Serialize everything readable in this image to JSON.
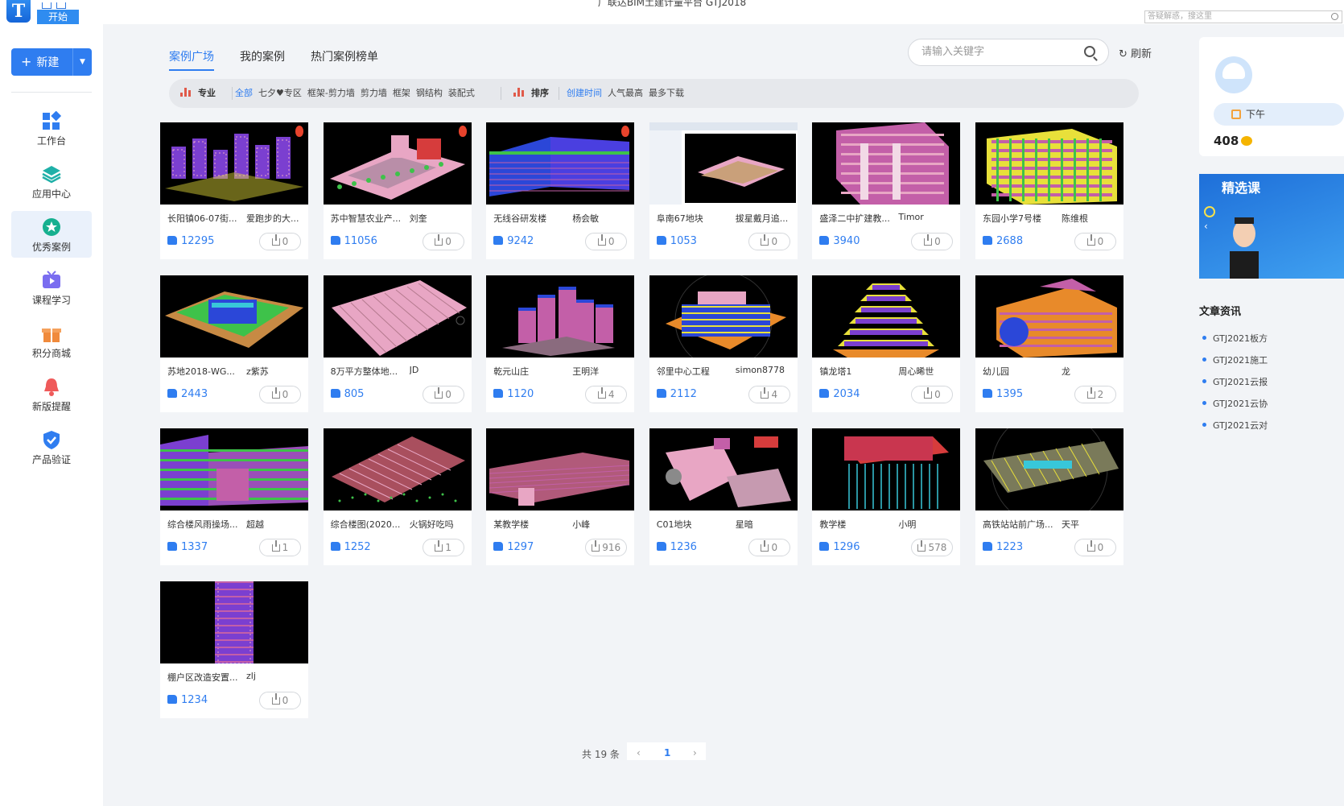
{
  "window": {
    "title": "广联达BIM土建计量平台 GTJ2018",
    "start_tab": "开始",
    "logo_letter": "T",
    "help_search_placeholder": "答疑解惑，搜这里"
  },
  "sidebar": {
    "new_button": "新建",
    "items": [
      {
        "label": "工作台",
        "icon": "workbench-icon"
      },
      {
        "label": "应用中心",
        "icon": "layers-icon"
      },
      {
        "label": "优秀案例",
        "icon": "star-icon",
        "active": true
      },
      {
        "label": "课程学习",
        "icon": "tv-icon"
      },
      {
        "label": "积分商城",
        "icon": "gift-icon"
      },
      {
        "label": "新版提醒",
        "icon": "bell-icon"
      },
      {
        "label": "产品验证",
        "icon": "shield-check-icon"
      }
    ]
  },
  "main": {
    "tabs": [
      {
        "label": "案例广场",
        "active": true
      },
      {
        "label": "我的案例"
      },
      {
        "label": "热门案例榜单"
      }
    ],
    "search_placeholder": "请输入关键字",
    "refresh_label": "刷新",
    "filters": {
      "specialty_label": "专业",
      "specialty_options": [
        "全部",
        "七夕♥专区",
        "框架-剪力墙",
        "剪力墙",
        "框架",
        "钢结构",
        "装配式"
      ],
      "sort_label": "排序",
      "sort_options": [
        "创建时间",
        "人气最高",
        "最多下载"
      ]
    },
    "cards": [
      {
        "name": "长阳镇06-07街...",
        "author": "爱跑步的大...",
        "likes": "12295",
        "downloads": "0",
        "hot": true,
        "scene": "towers"
      },
      {
        "name": "苏中智慧农业产...",
        "author": "刘奎",
        "likes": "11056",
        "downloads": "0",
        "hot": true,
        "scene": "campus"
      },
      {
        "name": "无线谷研发楼",
        "author": "杨会敏",
        "likes": "9242",
        "downloads": "0",
        "hot": true,
        "scene": "blue-block"
      },
      {
        "name": "阜南67地块",
        "author": "拔星戴月追...",
        "likes": "1053",
        "downloads": "0",
        "hot": false,
        "scene": "software"
      },
      {
        "name": "盛泽二中扩建教...",
        "author": "Timor",
        "likes": "3940",
        "downloads": "0",
        "hot": false,
        "scene": "pink-block"
      },
      {
        "name": "东园小学7号楼",
        "author": "陈维根",
        "likes": "2688",
        "downloads": "0",
        "hot": false,
        "scene": "yellow-block"
      },
      {
        "name": "苏地2018-WG...",
        "author": "z紫苏",
        "likes": "2443",
        "downloads": "0",
        "hot": false,
        "scene": "green-roof"
      },
      {
        "name": "8万平方整体地...",
        "author": "JD",
        "likes": "805",
        "downloads": "0",
        "hot": false,
        "scene": "basement"
      },
      {
        "name": "乾元山庄",
        "author": "王明洋",
        "likes": "1120",
        "downloads": "4",
        "hot": false,
        "scene": "cluster"
      },
      {
        "name": "邻里中心工程",
        "author": "simon8778",
        "likes": "2112",
        "downloads": "4",
        "hot": false,
        "scene": "center"
      },
      {
        "name": "镇龙塔1",
        "author": "周心晞世",
        "likes": "2034",
        "downloads": "0",
        "hot": false,
        "scene": "pagoda"
      },
      {
        "name": "幼儿园",
        "author": "龙",
        "likes": "1395",
        "downloads": "2",
        "hot": false,
        "scene": "kindergarten"
      },
      {
        "name": "综合楼风雨操场...",
        "author": "超越",
        "likes": "1337",
        "downloads": "1",
        "hot": false,
        "scene": "purple-complex"
      },
      {
        "name": "综合楼图(2020...",
        "author": "火锅好吃吗",
        "likes": "1252",
        "downloads": "1",
        "hot": false,
        "scene": "slanted"
      },
      {
        "name": "某教学楼",
        "author": "小峰",
        "likes": "1297",
        "downloads": "916",
        "hot": false,
        "scene": "long-block"
      },
      {
        "name": "C01地块",
        "author": "星暗",
        "likes": "1236",
        "downloads": "0",
        "hot": false,
        "scene": "scattered"
      },
      {
        "name": "教学楼",
        "author": "小明",
        "likes": "1296",
        "downloads": "578",
        "hot": false,
        "scene": "piles"
      },
      {
        "name": "高铁站站前广场...",
        "author": "天平",
        "likes": "1223",
        "downloads": "0",
        "hot": false,
        "scene": "plaza"
      },
      {
        "name": "棚户区改造安置...",
        "author": "zlj",
        "likes": "1234",
        "downloads": "0",
        "hot": false,
        "scene": "tall-tower"
      }
    ],
    "pagination": {
      "total": "共 19 条",
      "prev": "‹",
      "current": "1",
      "next": "›"
    }
  },
  "right_panel": {
    "sign_in_label": "下午",
    "coins": "408",
    "banner_title": "精选课",
    "news_heading": "文章资讯",
    "news": [
      "GTJ2021板方",
      "GTJ2021施工",
      "GTJ2021云报",
      "GTJ2021云协",
      "GTJ2021云对"
    ]
  },
  "colors": {
    "accent": "#2f7df0",
    "hot": "#e8432c",
    "coin": "#f5b400"
  }
}
